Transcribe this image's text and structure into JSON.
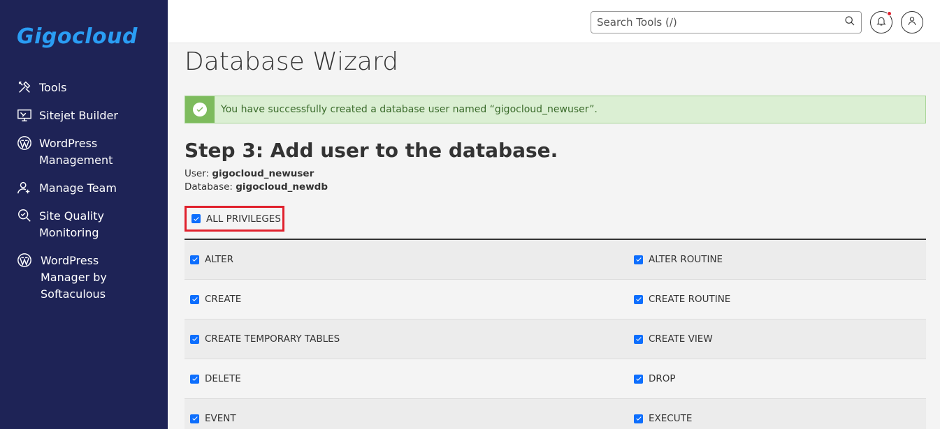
{
  "brand": {
    "logo_text": "Gigocloud",
    "logo_color": "#2a9df4"
  },
  "sidebar": {
    "items": [
      {
        "label": "Tools",
        "icon": "tools-icon"
      },
      {
        "label": "Sitejet Builder",
        "icon": "sitejet-icon"
      },
      {
        "label": "WordPress\nManagement",
        "icon": "wordpress-icon"
      },
      {
        "label": "Manage Team",
        "icon": "team-icon"
      },
      {
        "label": "Site Quality\nMonitoring",
        "icon": "site-quality-icon"
      },
      {
        "label": "WordPress\nManager by\nSoftaculous",
        "icon": "wordpress-icon"
      }
    ]
  },
  "header": {
    "search_placeholder": "Search Tools (/)"
  },
  "main": {
    "page_title": "Database Wizard",
    "alert_text": "You have successfully created a database user named “gigocloud_newuser”.",
    "step_title": "Step 3: Add user to the database.",
    "user_label": "User:",
    "user_value": "gigocloud_newuser",
    "database_label": "Database:",
    "database_value": "gigocloud_newdb",
    "all_privileges_label": "ALL PRIVILEGES",
    "privileges": [
      [
        "ALTER",
        "ALTER ROUTINE"
      ],
      [
        "CREATE",
        "CREATE ROUTINE"
      ],
      [
        "CREATE TEMPORARY TABLES",
        "CREATE VIEW"
      ],
      [
        "DELETE",
        "DROP"
      ],
      [
        "EVENT",
        "EXECUTE"
      ]
    ]
  },
  "colors": {
    "sidebar_bg": "#1e2356",
    "success_bg": "#dbefd3",
    "highlight_border": "#e0212d",
    "checkbox": "#0d6efd"
  }
}
